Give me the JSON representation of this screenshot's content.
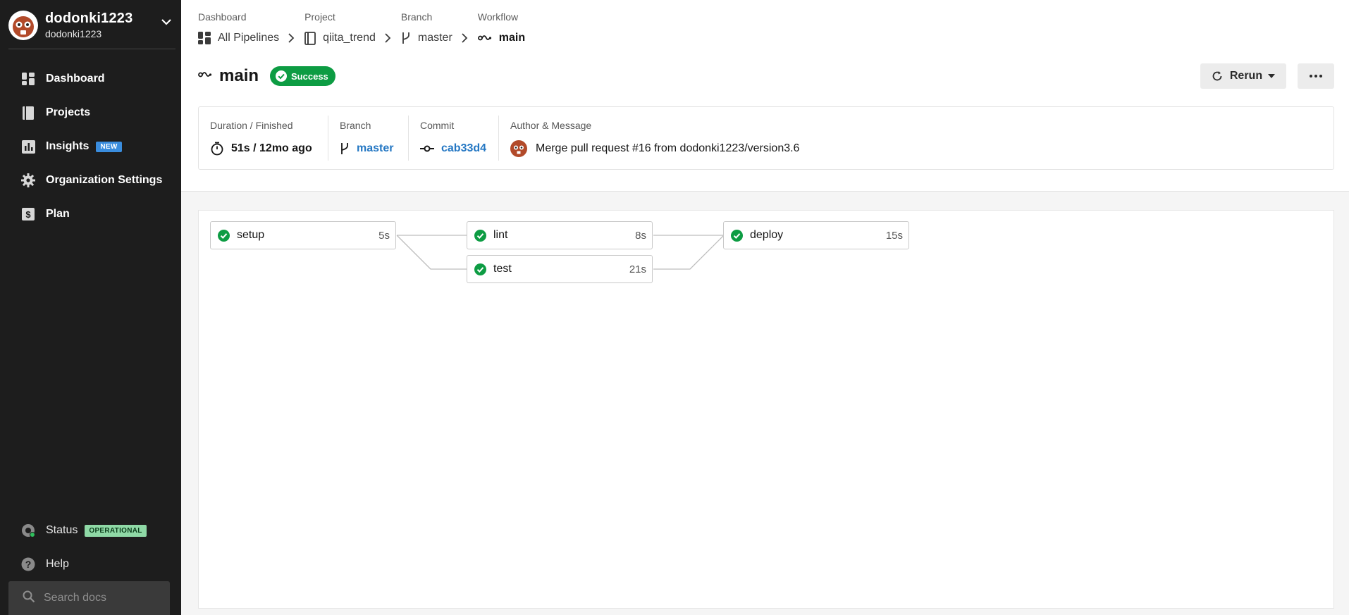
{
  "sidebar": {
    "org_name": "dodonki1223",
    "org_sub": "dodonki1223",
    "items": [
      {
        "label": "Dashboard",
        "icon": "dashboard-icon"
      },
      {
        "label": "Projects",
        "icon": "book-icon"
      },
      {
        "label": "Insights",
        "icon": "insights-icon",
        "badge": "NEW"
      },
      {
        "label": "Organization Settings",
        "icon": "gear-icon"
      },
      {
        "label": "Plan",
        "icon": "dollar-icon"
      }
    ],
    "status": {
      "label": "Status",
      "badge": "OPERATIONAL"
    },
    "help": {
      "label": "Help"
    },
    "search": {
      "placeholder": "Search docs"
    }
  },
  "breadcrumbs": [
    {
      "label": "Dashboard",
      "value": "All Pipelines"
    },
    {
      "label": "Project",
      "value": "qiita_trend"
    },
    {
      "label": "Branch",
      "value": "master"
    },
    {
      "label": "Workflow",
      "value": "main"
    }
  ],
  "workflow": {
    "title": "main",
    "status": "Success",
    "rerun_label": "Rerun"
  },
  "info": {
    "duration_label": "Duration / Finished",
    "duration_value": "51s / 12mo ago",
    "branch_label": "Branch",
    "branch_value": "master",
    "commit_label": "Commit",
    "commit_value": "cab33d4",
    "author_label": "Author & Message",
    "message": "Merge pull request #16 from dodonki1223/version3.6"
  },
  "jobs": [
    {
      "name": "setup",
      "duration": "5s"
    },
    {
      "name": "lint",
      "duration": "8s"
    },
    {
      "name": "test",
      "duration": "21s"
    },
    {
      "name": "deploy",
      "duration": "15s"
    }
  ],
  "colors": {
    "sidebar_bg": "#1d1d1d",
    "success": "#0d9c43",
    "link": "#2477c3",
    "new_badge": "#3a8dde",
    "operational_badge": "#8fd9a6"
  }
}
